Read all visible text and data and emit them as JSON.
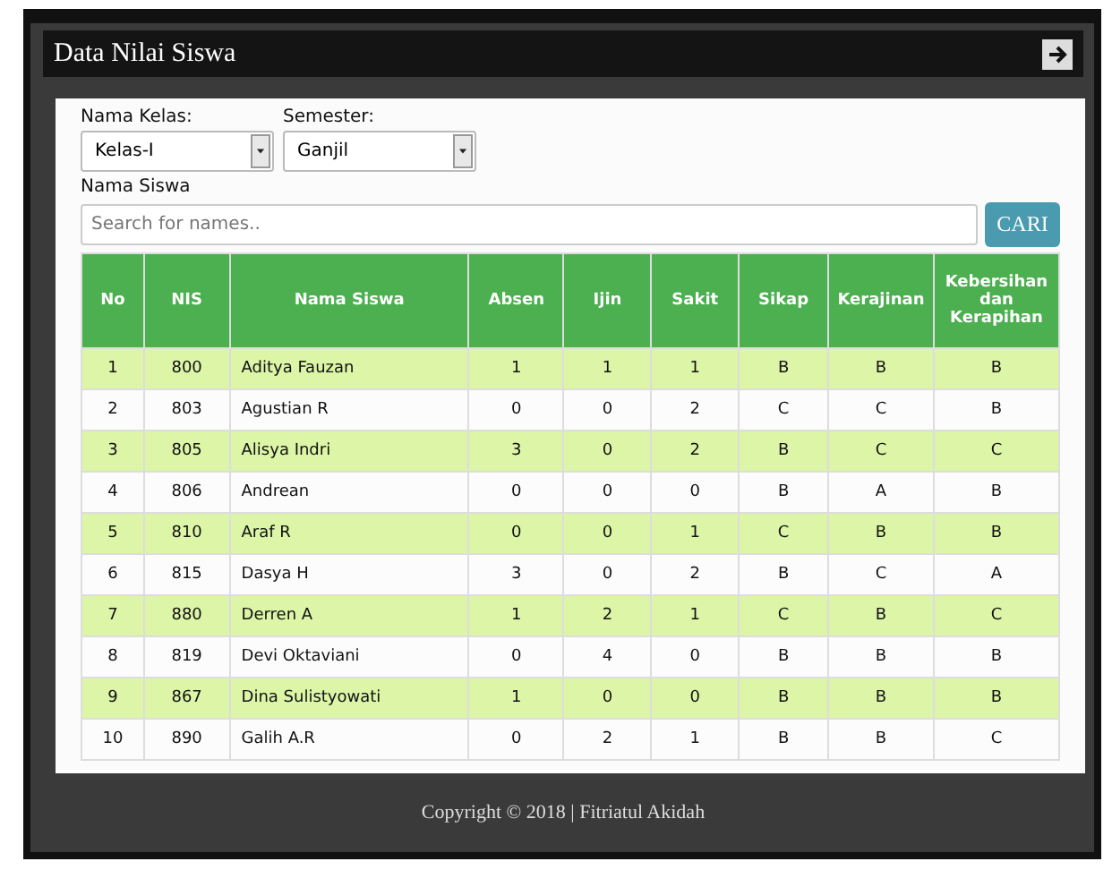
{
  "window": {
    "title": "Data Nilai Siswa"
  },
  "filters": [
    {
      "label": "Nama Kelas:",
      "value": "Kelas-I"
    },
    {
      "label": "Semester:",
      "value": "Ganjil"
    }
  ],
  "search": {
    "label": "Nama Siswa",
    "placeholder": "Search for names..",
    "button": "CARI"
  },
  "table": {
    "columns": [
      "No",
      "NIS",
      "Nama Siswa",
      "Absen",
      "Ijin",
      "Sakit",
      "Sikap",
      "Kerajinan",
      "Kebersihan dan Kerapihan"
    ],
    "rows": [
      [
        "1",
        "800",
        "Aditya Fauzan",
        "1",
        "1",
        "1",
        "B",
        "B",
        "B"
      ],
      [
        "2",
        "803",
        "Agustian R",
        "0",
        "0",
        "2",
        "C",
        "C",
        "B"
      ],
      [
        "3",
        "805",
        "Alisya Indri",
        "3",
        "0",
        "2",
        "B",
        "C",
        "C"
      ],
      [
        "4",
        "806",
        "Andrean",
        "0",
        "0",
        "0",
        "B",
        "A",
        "B"
      ],
      [
        "5",
        "810",
        "Araf R",
        "0",
        "0",
        "1",
        "C",
        "B",
        "B"
      ],
      [
        "6",
        "815",
        "Dasya H",
        "3",
        "0",
        "2",
        "B",
        "C",
        "A"
      ],
      [
        "7",
        "880",
        "Derren A",
        "1",
        "2",
        "1",
        "C",
        "B",
        "C"
      ],
      [
        "8",
        "819",
        "Devi Oktaviani",
        "0",
        "4",
        "0",
        "B",
        "B",
        "B"
      ],
      [
        "9",
        "867",
        "Dina Sulistyowati",
        "1",
        "0",
        "0",
        "B",
        "B",
        "B"
      ],
      [
        "10",
        "890",
        "Galih A.R",
        "0",
        "2",
        "1",
        "B",
        "B",
        "C"
      ]
    ]
  },
  "footer": "Copyright © 2018 | Fitriatul Akidah"
}
